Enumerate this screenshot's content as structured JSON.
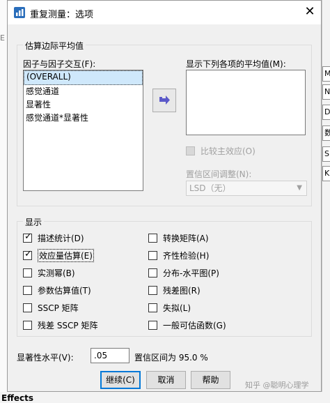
{
  "dialog": {
    "title": "重复测量：选项",
    "close_glyph": "✕"
  },
  "background": {
    "left_fragment": "E",
    "right_tabs": [
      "M",
      "N",
      "D",
      "数",
      "S",
      "K"
    ],
    "bottom_text": "Effects"
  },
  "estimated_marginal_means": {
    "group_title": "估算边际平均值",
    "factors_label": "因子与因子交互(F):",
    "factors_list": [
      "(OVERALL)",
      "感觉通道",
      "显著性",
      "感觉通道*显著性"
    ],
    "selected_index": 0,
    "display_means_label": "显示下列各项的平均值(M):",
    "compare_main_effects_label": "比较主效应(O)",
    "ci_adjustment_label": "置信区间调整(N):",
    "ci_adjustment_value": "LSD（无）"
  },
  "display": {
    "group_title": "显示",
    "options": [
      {
        "label": "描述统计(D)",
        "checked": true
      },
      {
        "label": "转换矩阵(A)",
        "checked": false
      },
      {
        "label": "效应量估算(E)",
        "checked": true
      },
      {
        "label": "齐性检验(H)",
        "checked": false
      },
      {
        "label": "实测幂(B)",
        "checked": false
      },
      {
        "label": "分布-水平图(P)",
        "checked": false
      },
      {
        "label": "参数估算值(T)",
        "checked": false
      },
      {
        "label": "残差图(R)",
        "checked": false
      },
      {
        "label": "SSCP 矩阵",
        "checked": false
      },
      {
        "label": "失拟(L)",
        "checked": false
      },
      {
        "label": "残差 SSCP 矩阵",
        "checked": false
      },
      {
        "label": "一般可估函数(G)",
        "checked": false
      }
    ]
  },
  "significance": {
    "label": "显著性水平(V):",
    "value": ".05",
    "ci_text": "置信区间为 95.0 %"
  },
  "buttons": {
    "continue": "继续(C)",
    "cancel": "取消",
    "help": "帮助"
  },
  "watermark": "知乎 @聪明心理学",
  "colors": {
    "dialog_bg": "#f0f0f0",
    "accent": "#0078d7",
    "selection": "#cfe8fb",
    "arrow_icon": "#5b59c9"
  },
  "icons": {
    "app": "spss-app-icon",
    "move": "arrow-right-icon",
    "close": "close-icon",
    "dropdown": "chevron-down-icon"
  }
}
